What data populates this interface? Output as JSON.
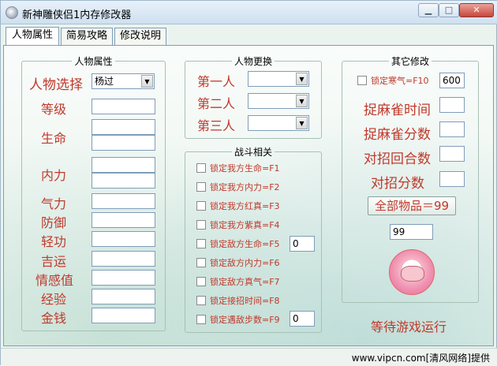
{
  "window": {
    "title": "新神雕侠侣1内存修改器"
  },
  "tabs": [
    "人物属性",
    "简易攻略",
    "修改说明"
  ],
  "attr_group": {
    "title": "人物属性",
    "select_label": "人物选择",
    "select_value": "杨过",
    "fields": [
      "等级",
      "生命",
      "内力",
      "气力",
      "防御",
      "轻功",
      "吉运",
      "情感值",
      "经验",
      "金钱"
    ]
  },
  "swap_group": {
    "title": "人物更换",
    "slots": [
      "第一人",
      "第二人",
      "第三人"
    ]
  },
  "battle_group": {
    "title": "战斗相关",
    "options": [
      "锁定我方生命=F1",
      "锁定我方内力=F2",
      "锁定我方红真=F3",
      "锁定我方紫真=F4",
      "锁定敌方生命=F5",
      "锁定敌方内力=F6",
      "锁定敌方真气=F7",
      "锁定接招时间=F8",
      "锁定遇敌步数=F9"
    ],
    "enemy_hp_value": "0",
    "encounter_value": "0"
  },
  "other_group": {
    "title": "其它修改",
    "cold_label": "锁定寒气=F10",
    "cold_value": "600",
    "fields": [
      "捉麻雀时间",
      "捉麻雀分数",
      "对招回合数",
      "对招分数"
    ],
    "all_items_button": "全部物品＝99",
    "all_items_value": "99"
  },
  "status": "等待游戏运行",
  "footer": "www.vipcn.com[清风网络]提供",
  "colors": {
    "label_red": "#c0392b",
    "border_blue": "#7f9db9"
  }
}
